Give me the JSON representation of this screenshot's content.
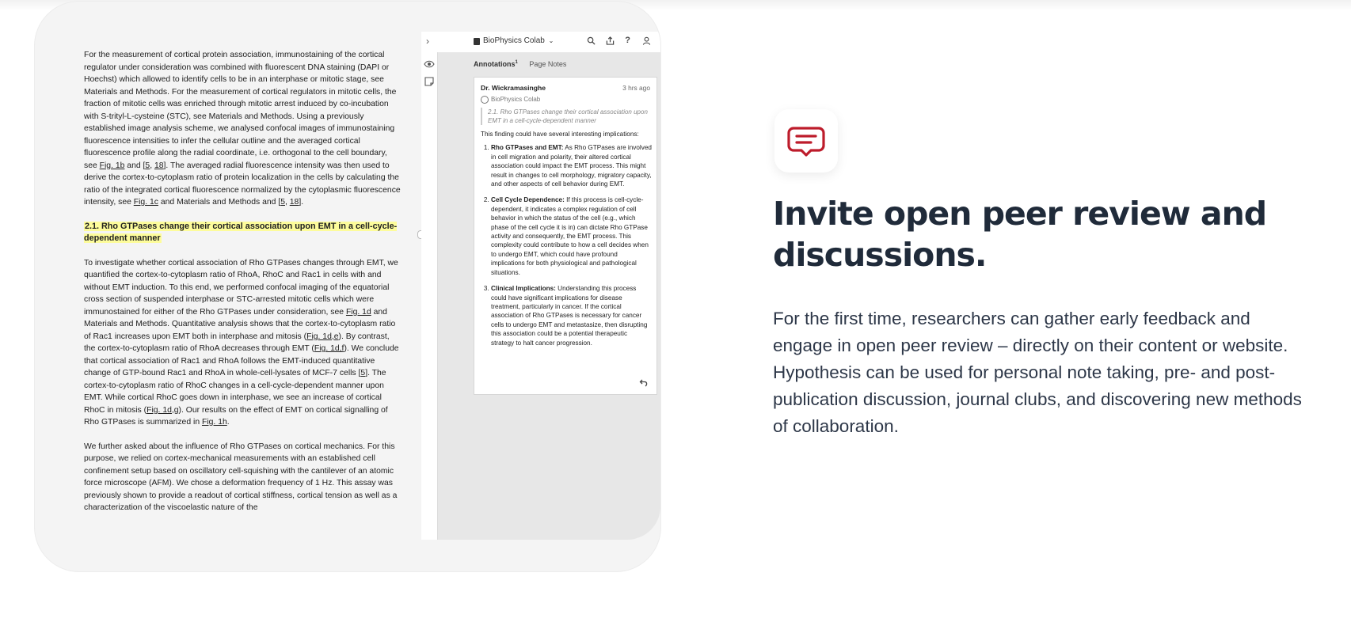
{
  "document": {
    "para1_parts": [
      "For the measurement of cortical protein association, immunostaining of the cortical regulator under consideration was combined with fluorescent DNA staining (DAPI or Hoechst) which allowed to identify cells to be in an interphase or mitotic stage, see Materials and Methods. For the measurement of cortical regulators in mitotic cells, the fraction of mitotic cells was enriched through mitotic arrest induced by co-incubation with S-trityl-L-cysteine (STC), see Materials and Methods. Using a previously established image analysis scheme, we analysed confocal images of immunostaining fluorescence intensities to infer the cellular outline and the averaged cortical fluorescence profile along the radial coordinate, i.e. orthogonal to the cell boundary, see ",
      "Fig. 1b",
      " and [",
      "5",
      ", ",
      "18",
      "]. The averaged radial fluorescence intensity was then used to derive the cortex-to-cytoplasm ratio of protein localization in the cells by calculating the ratio of the integrated cortical fluorescence normalized by the cytoplasmic fluorescence intensity, see ",
      "Fig. 1c",
      " and Materials and Methods and [",
      "5",
      ", ",
      "18",
      "]."
    ],
    "heading": "2.1. Rho GTPases change their cortical association upon EMT in a cell-cycle-dependent manner",
    "para2_parts": [
      "To investigate whether cortical association of Rho GTPases changes through EMT, we quantified the cortex-to-cytoplasm ratio of RhoA, RhoC and Rac1 in cells with and without EMT induction. To this end, we performed confocal imaging of the equatorial cross section of suspended interphase or STC-arrested mitotic cells which were immunostained for either of the Rho GTPases under consideration, see ",
      "Fig. 1d",
      " and Materials and Methods. Quantitative analysis shows that the cortex-to-cytoplasm ratio of Rac1 increases upon EMT both in interphase and mitosis (",
      "Fig. 1d,e",
      "). By contrast, the cortex-to-cytoplasm ratio of RhoA decreases through EMT (",
      "Fig. 1d,f",
      "). We conclude that cortical association of Rac1 and RhoA follows the EMT-induced quantitative change of GTP-bound Rac1 and RhoA in whole-cell-lysates of MCF-7 cells [",
      "5",
      "]. The cortex-to-cytoplasm ratio of RhoC changes in a cell-cycle-dependent manner upon EMT. While cortical RhoC goes down in interphase, we see an increase of cortical RhoC in mitosis (",
      "Fig. 1d,g",
      "). Our results on the effect of EMT on cortical signalling of Rho GTPases is summarized in ",
      "Fig. 1h",
      "."
    ],
    "para3": "We further asked about the influence of Rho GTPases on cortical mechanics. For this purpose, we relied on cortex-mechanical measurements with an established cell confinement setup based on oscillatory cell-squishing with the cantilever of an atomic force microscope (AFM). We chose a deformation frequency of 1 Hz. This assay was previously shown to provide a readout of cortical stiffness, cortical tension as well as a characterization of the viscoelastic nature of the"
  },
  "sidebar": {
    "collapse_icon": "›",
    "group_name": "BioPhysics Colab",
    "group_chevron": "⌄",
    "top_icons": [
      "search-icon",
      "share-icon",
      "help-icon",
      "user-icon"
    ],
    "tabs": {
      "annotations_label": "Annotations",
      "annotations_count": "1",
      "page_notes_label": "Page Notes"
    },
    "highlight_marker_count": "1",
    "annotation": {
      "author": "Dr. Wickramasinghe",
      "time": "3 hrs ago",
      "group": "BioPhysics Colab",
      "quote": "2.1. Rho GTPases change their cortical association upon EMT in a cell-cycle-dependent manner",
      "intro": "This finding could have several interesting implications:",
      "items": [
        {
          "title": "Rho GTPases and EMT:",
          "text": " As Rho GTPases are involved in cell migration and polarity, their altered cortical association could impact the EMT process. This might result in changes to cell morphology, migratory capacity, and other aspects of cell behavior during EMT."
        },
        {
          "title": "Cell Cycle Dependence:",
          "text": " If this process is cell-cycle-dependent, it indicates a complex regulation of cell behavior in which the status of the cell (e.g., which phase of the cell cycle it is in) can dictate Rho GTPase activity and consequently, the EMT process. This complexity could contribute to how a cell decides when to undergo EMT, which could have profound implications for both physiological and pathological situations."
        },
        {
          "title": "Clinical Implications:",
          "text": " Understanding this process could have significant implications for disease treatment, particularly in cancer. If the cortical association of Rho GTPases is necessary for cancer cells to undergo EMT and metastasize, then disrupting this association could be a potential therapeutic strategy to halt cancer progression."
        }
      ]
    }
  },
  "feature": {
    "icon": "chat-bubble-icon",
    "icon_color": "#bd1c2b",
    "headline": "Invite open peer review and discussions.",
    "description": "For the first time, researchers can gather early feedback and engage in open peer review – directly on their content or website. Hypothesis can be used for personal note taking, pre- and post-publication discussion, journal clubs, and discovering new methods of collaboration."
  }
}
